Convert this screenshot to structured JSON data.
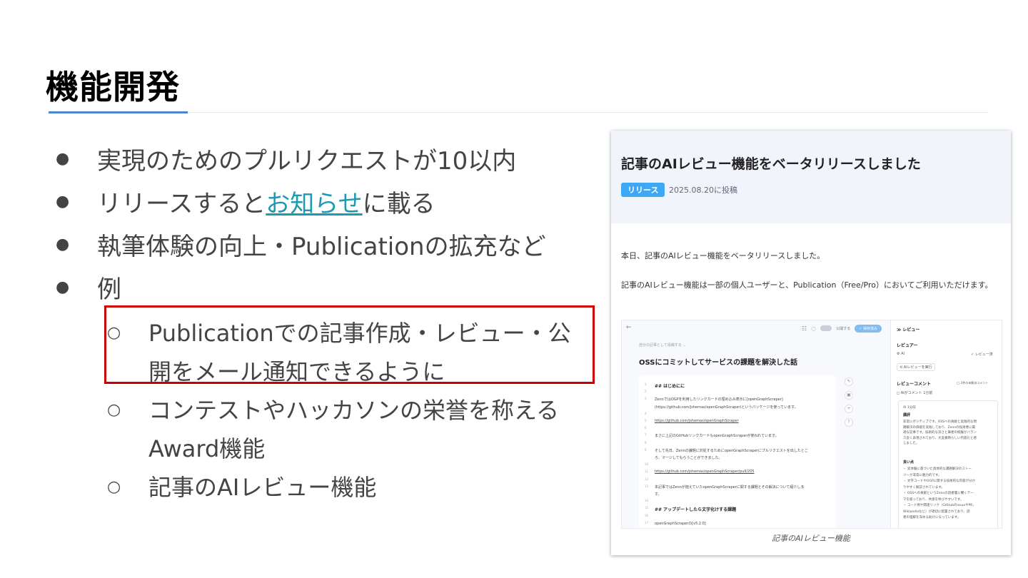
{
  "title": "機能開発",
  "bullets": {
    "b1": "実現のためのプルリクエストが10以内",
    "b2_pre": "リリースすると",
    "b2_link": "お知らせ",
    "b2_post": "に載る",
    "b3": "執筆体験の向上・Publicationの拡充など",
    "b4": "例",
    "sub": [
      "Publicationでの記事作成・レビュー・公開をメール通知できるように",
      "コンテストやハッカソンの栄誉を称えるAward機能",
      "記事のAIレビュー機能"
    ]
  },
  "card": {
    "title": "記事のAIレビュー機能をベータリリースしました",
    "tag": "リリース",
    "date": "2025.08.20に投稿",
    "p1": "本日、記事のAIレビュー機能をベータリリースしました。",
    "p2": "記事のAIレビュー機能は一部の個人ユーザーと、Publication（Free/Pro）においてご利用いただけます。",
    "caption": "記事のAIレビュー機能",
    "shot": {
      "back": "←",
      "publish_label": "公開する",
      "save_label": "✓ 保存済み",
      "as_label": "自分の記事として投稿する ⌄",
      "heading": "OSSにコミットしてサービスの課題を解決した話",
      "code": [
        {
          "n": "1",
          "t": "## はじめにに"
        },
        {
          "n": "2",
          "t": ""
        },
        {
          "n": "3",
          "t": "ZennではOGPを利用したリンクカードの埋め込み表示に[openGraphScraper]"
        },
        {
          "n": "",
          "t": "(https://github.com/jshemas/openGraphScraper)というパッケージを使っています。"
        },
        {
          "n": "4",
          "t": ""
        },
        {
          "n": "5",
          "t": "https://github.com/jshemas/openGraphScraper"
        },
        {
          "n": "6",
          "t": ""
        },
        {
          "n": "7",
          "t": "まさに上記のGitHubリンクカードもopenGraphScraperが使われています。"
        },
        {
          "n": "8",
          "t": ""
        },
        {
          "n": "9",
          "t": "そして先日、Zennの課題に対処するためにopenGraphScraperにプルリクエストを出したとこ"
        },
        {
          "n": "",
          "t": "ろ、マージしてもらうことができました。"
        },
        {
          "n": "10",
          "t": ""
        },
        {
          "n": "11",
          "t": "https://github.com/jshemas/openGraphScraper/pull/205"
        },
        {
          "n": "12",
          "t": ""
        },
        {
          "n": "13",
          "t": "本記事ではZennが抱えていたopenGraphScraperに関する課題とその解決について紹介しま"
        },
        {
          "n": "",
          "t": "す。"
        },
        {
          "n": "14",
          "t": ""
        },
        {
          "n": "15",
          "t": "## アップデートしたら文字化けする課題"
        },
        {
          "n": "16",
          "t": ""
        },
        {
          "n": "17",
          "t": "openGraphScraperの[v5.2.0]"
        }
      ],
      "panel": {
        "head": "≫ レビュー",
        "reviewer": "レビュアー",
        "ai": "⚙ AI",
        "reviewed": "✓ レビュー済",
        "run": "⟲ AIレビューを実行",
        "comments": "レビューコメント",
        "unresolved": "◯ 2件の未解決コメント",
        "ai_comment": "◻ AIがコメント 1分前",
        "c_name": "AI 1分前",
        "c_title": "講評",
        "c_body": [
          "非常にポジティブです。OSSへの貢献と実践的な問",
          "題解決の価値を実践しており、Zennの技術者に最",
          "適な記事です。技術的な深さと筆者の経験がバラン",
          "ス良く表現されており、大変素晴らしい内容だと感",
          "じました。"
        ],
        "good": "良い点",
        "good_items": [
          "・ 実体験に基づいた具体的な課題解決のストー",
          "  リーが非常に魅力的です。",
          "・ 文字コードやOGPに関する技術的な内容が分か",
          "  りやすく解説されています。",
          "・ OSSへの貢献というZennの読者層に響くテー",
          "  マを扱っており、共感を呼びやすいです。",
          "・ コード例や関連リンク（GitHubのissueやPR、",
          "  Wikipediaなど）が適切に配置されており、読",
          "  者の理解を深める助けになっています。"
        ]
      }
    }
  },
  "colors": {
    "accent_line": "#4a86d6",
    "link": "#1a9bb2",
    "highlight_border": "#cc0000",
    "tag_bg": "#3ea8f5"
  }
}
